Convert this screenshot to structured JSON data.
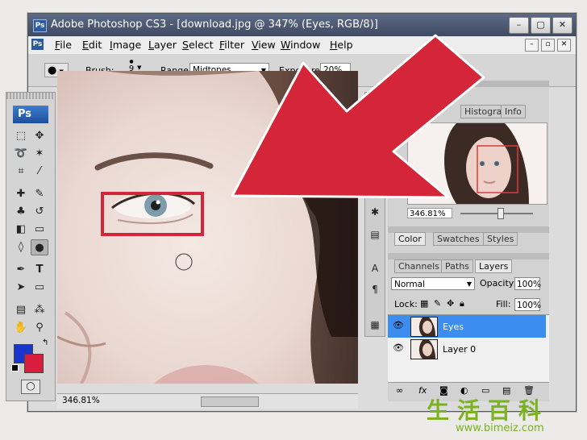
{
  "window": {
    "title": "Adobe Photoshop CS3 - [download.jpg @ 347% (Eyes, RGB/8)]",
    "app_badge": "Ps",
    "buttons": [
      "–",
      "▢",
      "✕"
    ]
  },
  "menu": {
    "items": [
      "File",
      "Edit",
      "Image",
      "Layer",
      "Select",
      "Filter",
      "View",
      "Window",
      "Help"
    ],
    "doc_buttons": [
      "–",
      "▫",
      "✕"
    ]
  },
  "options": {
    "brush_label": "Brush:",
    "brush_size": "9",
    "range_label": "Range:",
    "range_value": "Midtones",
    "exposure_label": "Exposure:",
    "exposure_value": "20%"
  },
  "toolbox": {
    "logo": "Ps",
    "foreground_color": "#1a35c9",
    "background_color": "#d81e3c"
  },
  "canvas": {
    "zoom": "346.81%"
  },
  "navigator": {
    "tabs": [
      "Histogram",
      "Info"
    ],
    "zoom": "346.81%"
  },
  "color_panel": {
    "tabs": [
      "Color",
      "Swatches",
      "Styles"
    ]
  },
  "layers_panel": {
    "tabs": [
      "Channels",
      "Paths",
      "Layers"
    ],
    "blend_mode": "Normal",
    "opacity_label": "Opacity:",
    "opacity_value": "100%",
    "lock_label": "Lock:",
    "fill_label": "Fill:",
    "fill_value": "100%",
    "layers": [
      {
        "name": "Eyes",
        "selected": true
      },
      {
        "name": "Layer 0",
        "selected": false
      }
    ]
  },
  "colors": {
    "accent_arrow": "#d42638",
    "selection_blue": "#3d8cf0",
    "watermark_green": "#7bb21f"
  },
  "watermark": {
    "chars": "生活百科",
    "url": "www.bimeiz.com"
  }
}
